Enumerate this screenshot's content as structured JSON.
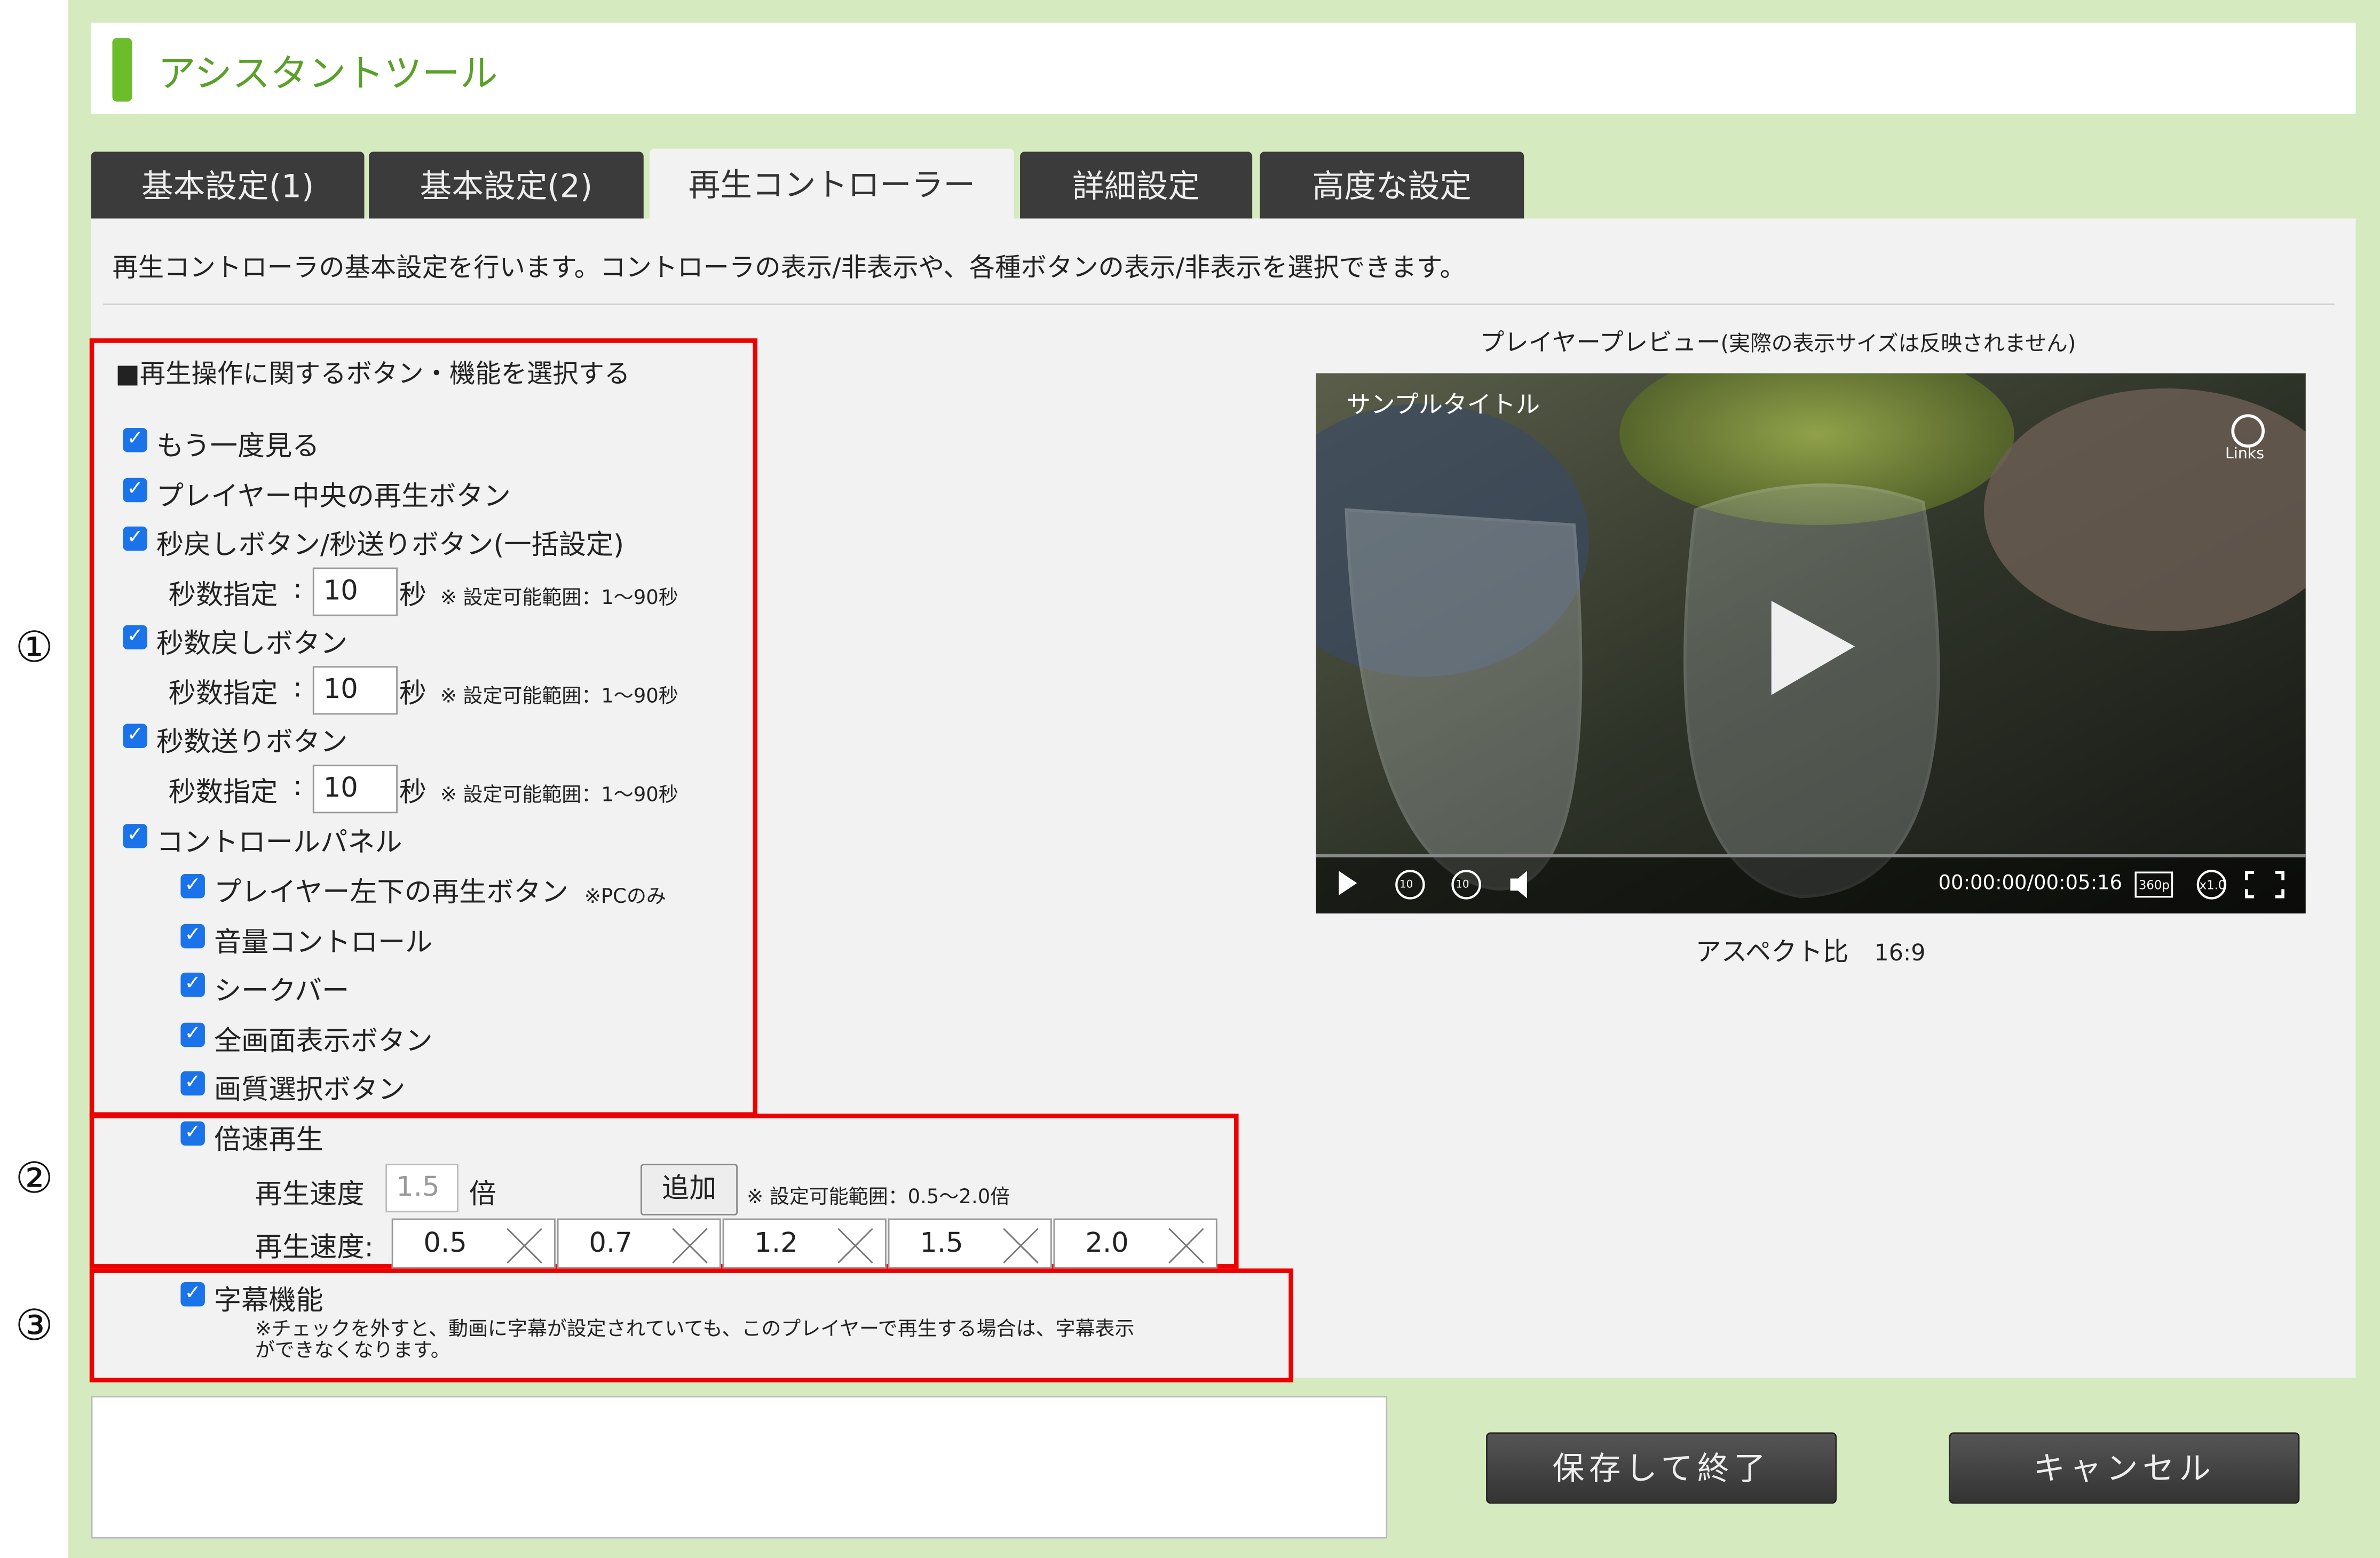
{
  "app": {
    "title": "アシスタントツール"
  },
  "tabs": [
    {
      "label": "基本設定(1)"
    },
    {
      "label": "基本設定(2)"
    },
    {
      "label": "再生コントローラー"
    },
    {
      "label": "詳細設定"
    },
    {
      "label": "高度な設定"
    }
  ],
  "active_tab": "再生コントローラー",
  "description": "再生コントローラの基本設定を行います。コントローラの表示/非表示や、各種ボタンの表示/非表示を選択できます。",
  "annotations": [
    "①",
    "②",
    "③"
  ],
  "section1": {
    "heading": "■再生操作に関するボタン・機能を選択する",
    "options": {
      "replay": "もう一度見る",
      "center_play": "プレイヤー中央の再生ボタン",
      "skip_both": "秒戻しボタン/秒送りボタン(一括設定)",
      "skip_back": "秒数戻しボタン",
      "skip_fwd": "秒数送りボタン",
      "control_panel": "コントロールパネル",
      "bottom_left_play": "プレイヤー左下の再生ボタン",
      "bottom_left_play_note": "※PCのみ",
      "volume": "音量コントロール",
      "seekbar": "シークバー",
      "fullscreen": "全画面表示ボタン",
      "quality": "画質選択ボタン"
    },
    "seconds_label": "秒数指定",
    "seconds_unit": "秒",
    "seconds_range": "※ 設定可能範囲：1～90秒",
    "seconds_values": [
      "10",
      "10",
      "10"
    ]
  },
  "section2": {
    "label": "倍速再生",
    "speed_label": "再生速度",
    "speed_input": "1.5",
    "speed_unit": "倍",
    "add_button": "追加",
    "range": "※ 設定可能範囲：0.5～2.0倍",
    "speeds_label": "再生速度:",
    "speeds": [
      "0.5",
      "0.7",
      "1.2",
      "1.5",
      "2.0"
    ]
  },
  "section3": {
    "label": "字幕機能",
    "note_line1": "※チェックを外すと、動画に字幕が設定されていても、このプレイヤーで再生する場合は、字幕表示",
    "note_line2": "ができなくなります。"
  },
  "preview": {
    "label": "プレイヤープレビュー",
    "label_note": "(実際の表示サイズは反映されません)",
    "video_title": "サンプルタイトル",
    "links_label": "Links",
    "time": "00:00:00/00:05:16",
    "quality": "360p",
    "speed": "x1.0",
    "skip_seconds": "10",
    "aspect_label": "アスペクト比",
    "aspect_value": "16:9"
  },
  "buttons": {
    "save": "保存して終了",
    "cancel": "キャンセル"
  },
  "colors": {
    "accent_green": "#6bbd2a",
    "page_green": "#d5ebbf",
    "highlight_red": "#e00000",
    "checkbox_blue": "#1a73e8"
  }
}
